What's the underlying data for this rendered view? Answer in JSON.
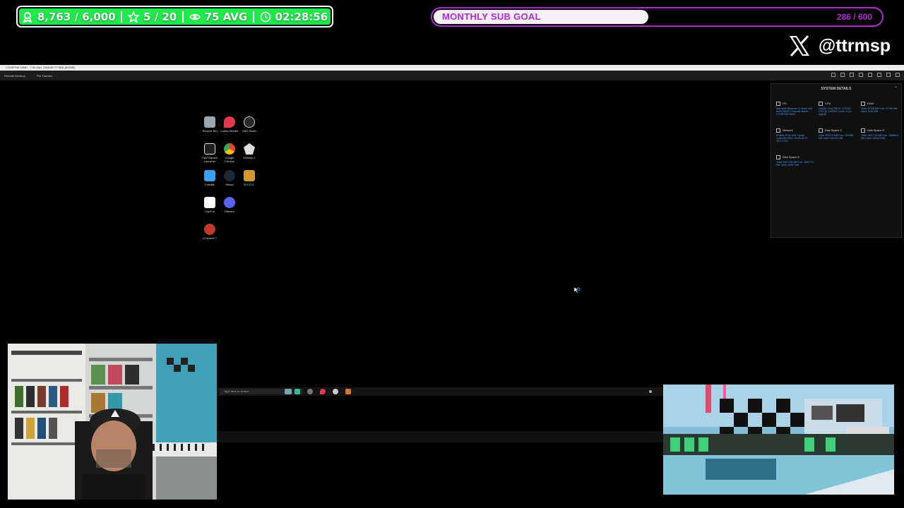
{
  "stats": {
    "followers": "8,763 / 6,000",
    "subs": "5 / 20",
    "avg_viewers": "75 AVG",
    "timer": "02:28:56",
    "icons": [
      "person-icon",
      "star-icon",
      "eye-icon",
      "clock-icon"
    ],
    "color": "#1ee84a"
  },
  "goal": {
    "label": "MONTHLY SUB GOAL",
    "value": "286 / 600",
    "progress": 0.477,
    "color": "#b12ad6"
  },
  "social": {
    "handle": "@ttrmsp"
  },
  "remote_desktop": {
    "title": "COURTNEYAMD - 7.50.2(#1 2264081777583) [5000B]",
    "menu": [
      "Remote Desktop",
      "File Transfer"
    ]
  },
  "desktop_icons": [
    {
      "label": "Recycle Bin",
      "color": "#9aa6b2"
    },
    {
      "label": "Lumia Stream",
      "color": "#e8384f"
    },
    {
      "label": "OBS Studio",
      "color": "#2b2b2b"
    },
    {
      "label": "Epic Games Launcher",
      "color": "#1f1f1f"
    },
    {
      "label": "Google Chrome",
      "color": "#ea4335"
    },
    {
      "label": "Destiny 2",
      "color": "#dddddd"
    },
    {
      "label": "Fortnite",
      "color": "#3aa1f0"
    },
    {
      "label": "Steam",
      "color": "#1b2838"
    },
    {
      "label": "R.E.P.O.",
      "color": "#d09a2c"
    },
    {
      "label": "CapCut",
      "color": "#ffffff"
    },
    {
      "label": "Discord",
      "color": "#5865f2"
    },
    {
      "label": "CCleaner 7",
      "color": "#c0392b"
    }
  ],
  "system_details": {
    "title": "SYSTEM DETAILS",
    "items": [
      {
        "label": "OS",
        "value": "Microsoft Windows 11 Home x64 Build 26100 Computer Name: COURTNEYAMD"
      },
      {
        "label": "CPU",
        "value": "Intel(R) Core(TM) i5 12700KF CPU @ 3.60GHz Cores: 8 (12 logical)"
      },
      {
        "label": "RAM",
        "value": "Total: 32768 MB Free: 23708 MB Used: 9060 MB"
      },
      {
        "label": "Network",
        "value": "Realtek PCIe GbE Family Controller MAC: 00:00:00 IP: 10.0.0.151"
      },
      {
        "label": "Disk Space C",
        "value": "Total: 953270 MB Free: 420088 MB Used: 533182 MB"
      },
      {
        "label": "Disk Space D",
        "value": "Total: 1907726 MB Free: 1668613 MB Used: 239113 MB"
      },
      {
        "label": "Disk Space E",
        "value": "Total: 1907728 MB Free: 1893771 MB Used: 13957 MB"
      }
    ]
  },
  "taskbar": {
    "search_placeholder": "Type here to search"
  }
}
